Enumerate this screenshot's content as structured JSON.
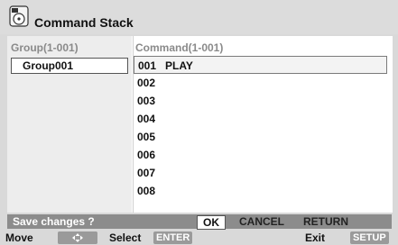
{
  "title": {
    "text": "Command Stack",
    "icon": "disc-folder-icon"
  },
  "group_column": {
    "header": "Group(1-001)",
    "items": [
      "Group001"
    ]
  },
  "command_column": {
    "header": "Command(1-001)",
    "rows": [
      {
        "num": "001",
        "action": "PLAY"
      },
      {
        "num": "002",
        "action": ""
      },
      {
        "num": "003",
        "action": ""
      },
      {
        "num": "004",
        "action": ""
      },
      {
        "num": "005",
        "action": ""
      },
      {
        "num": "006",
        "action": ""
      },
      {
        "num": "007",
        "action": ""
      },
      {
        "num": "008",
        "action": ""
      }
    ]
  },
  "status": {
    "question": "Save changes ?",
    "ok": "OK",
    "cancel": "CANCEL",
    "return": "RETURN"
  },
  "footer": {
    "move": "Move",
    "move_icon": "arrow-keys-icon",
    "select": "Select",
    "select_key": "ENTER",
    "exit": "Exit",
    "exit_key": "SETUP"
  }
}
